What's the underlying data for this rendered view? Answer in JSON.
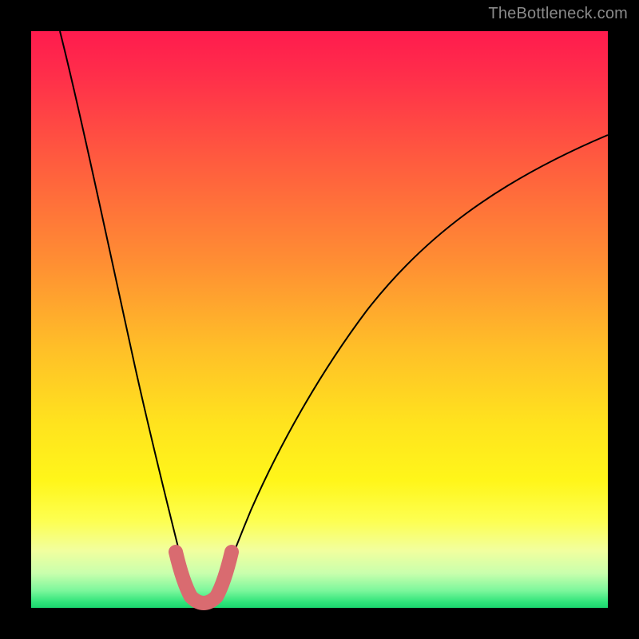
{
  "watermark": {
    "text": "TheBottleneck.com"
  },
  "chart_data": {
    "type": "line",
    "title": "",
    "xlabel": "",
    "ylabel": "",
    "xlim": [
      0,
      100
    ],
    "ylim": [
      0,
      100
    ],
    "grid": false,
    "legend": false,
    "series": [
      {
        "name": "bottleneck-curve-left",
        "color": "#000000",
        "x": [
          5,
          8,
          11,
          14,
          17,
          20,
          22,
          24,
          26,
          27.5
        ],
        "y": [
          100,
          87,
          73,
          58,
          45,
          31,
          21,
          13,
          6,
          2
        ]
      },
      {
        "name": "bottleneck-curve-right",
        "color": "#000000",
        "x": [
          32,
          34,
          37,
          41,
          46,
          52,
          59,
          67,
          76,
          86,
          100
        ],
        "y": [
          2,
          6,
          14,
          24,
          34,
          44,
          53,
          61,
          68,
          75,
          82
        ]
      },
      {
        "name": "optimal-band-marker",
        "color": "#d96b70",
        "x": [
          25,
          26.5,
          27.5,
          28.5,
          29.5,
          30.5,
          31.5,
          32.5,
          34
        ],
        "y": [
          9,
          4,
          2,
          1,
          1,
          1,
          2,
          4,
          9
        ]
      }
    ],
    "annotations": []
  }
}
